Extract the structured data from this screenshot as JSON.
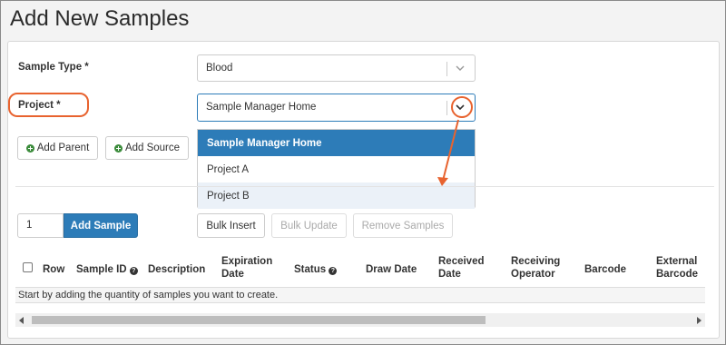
{
  "page": {
    "title": "Add New Samples"
  },
  "form": {
    "sample_type_label": "Sample Type *",
    "sample_type_value": "Blood",
    "project_label": "Project *",
    "project_value": "Sample Manager Home"
  },
  "dropdown": {
    "options": [
      "Sample Manager Home",
      "Project A",
      "Project B"
    ],
    "selected_index": 0
  },
  "parent_buttons": {
    "add_parent": "Add Parent",
    "add_source": "Add Source"
  },
  "toolbar": {
    "quantity_value": "1",
    "add_sample": "Add Sample",
    "bulk_insert": "Bulk Insert",
    "bulk_update": "Bulk Update",
    "remove_samples": "Remove Samples"
  },
  "grid": {
    "columns": {
      "row": "Row",
      "sample_id": "Sample ID",
      "description": "Description",
      "expiration_1": "Expiration",
      "expiration_2": "Date",
      "status": "Status",
      "draw_date": "Draw Date",
      "received_1": "Received",
      "received_2": "Date",
      "receiving_1": "Receiving",
      "receiving_2": "Operator",
      "barcode": "Barcode",
      "external_1": "External",
      "external_2": "Barcode"
    },
    "empty_message": "Start by adding the quantity of samples you want to create."
  },
  "colors": {
    "primary": "#2d7cb8",
    "annotation": "#e8632f",
    "add_icon": "#3c8c3c"
  },
  "icons": [
    "chevron-down-icon",
    "plus-circle-icon",
    "help-icon",
    "checkbox-icon",
    "scroll-left-icon",
    "scroll-right-icon"
  ]
}
